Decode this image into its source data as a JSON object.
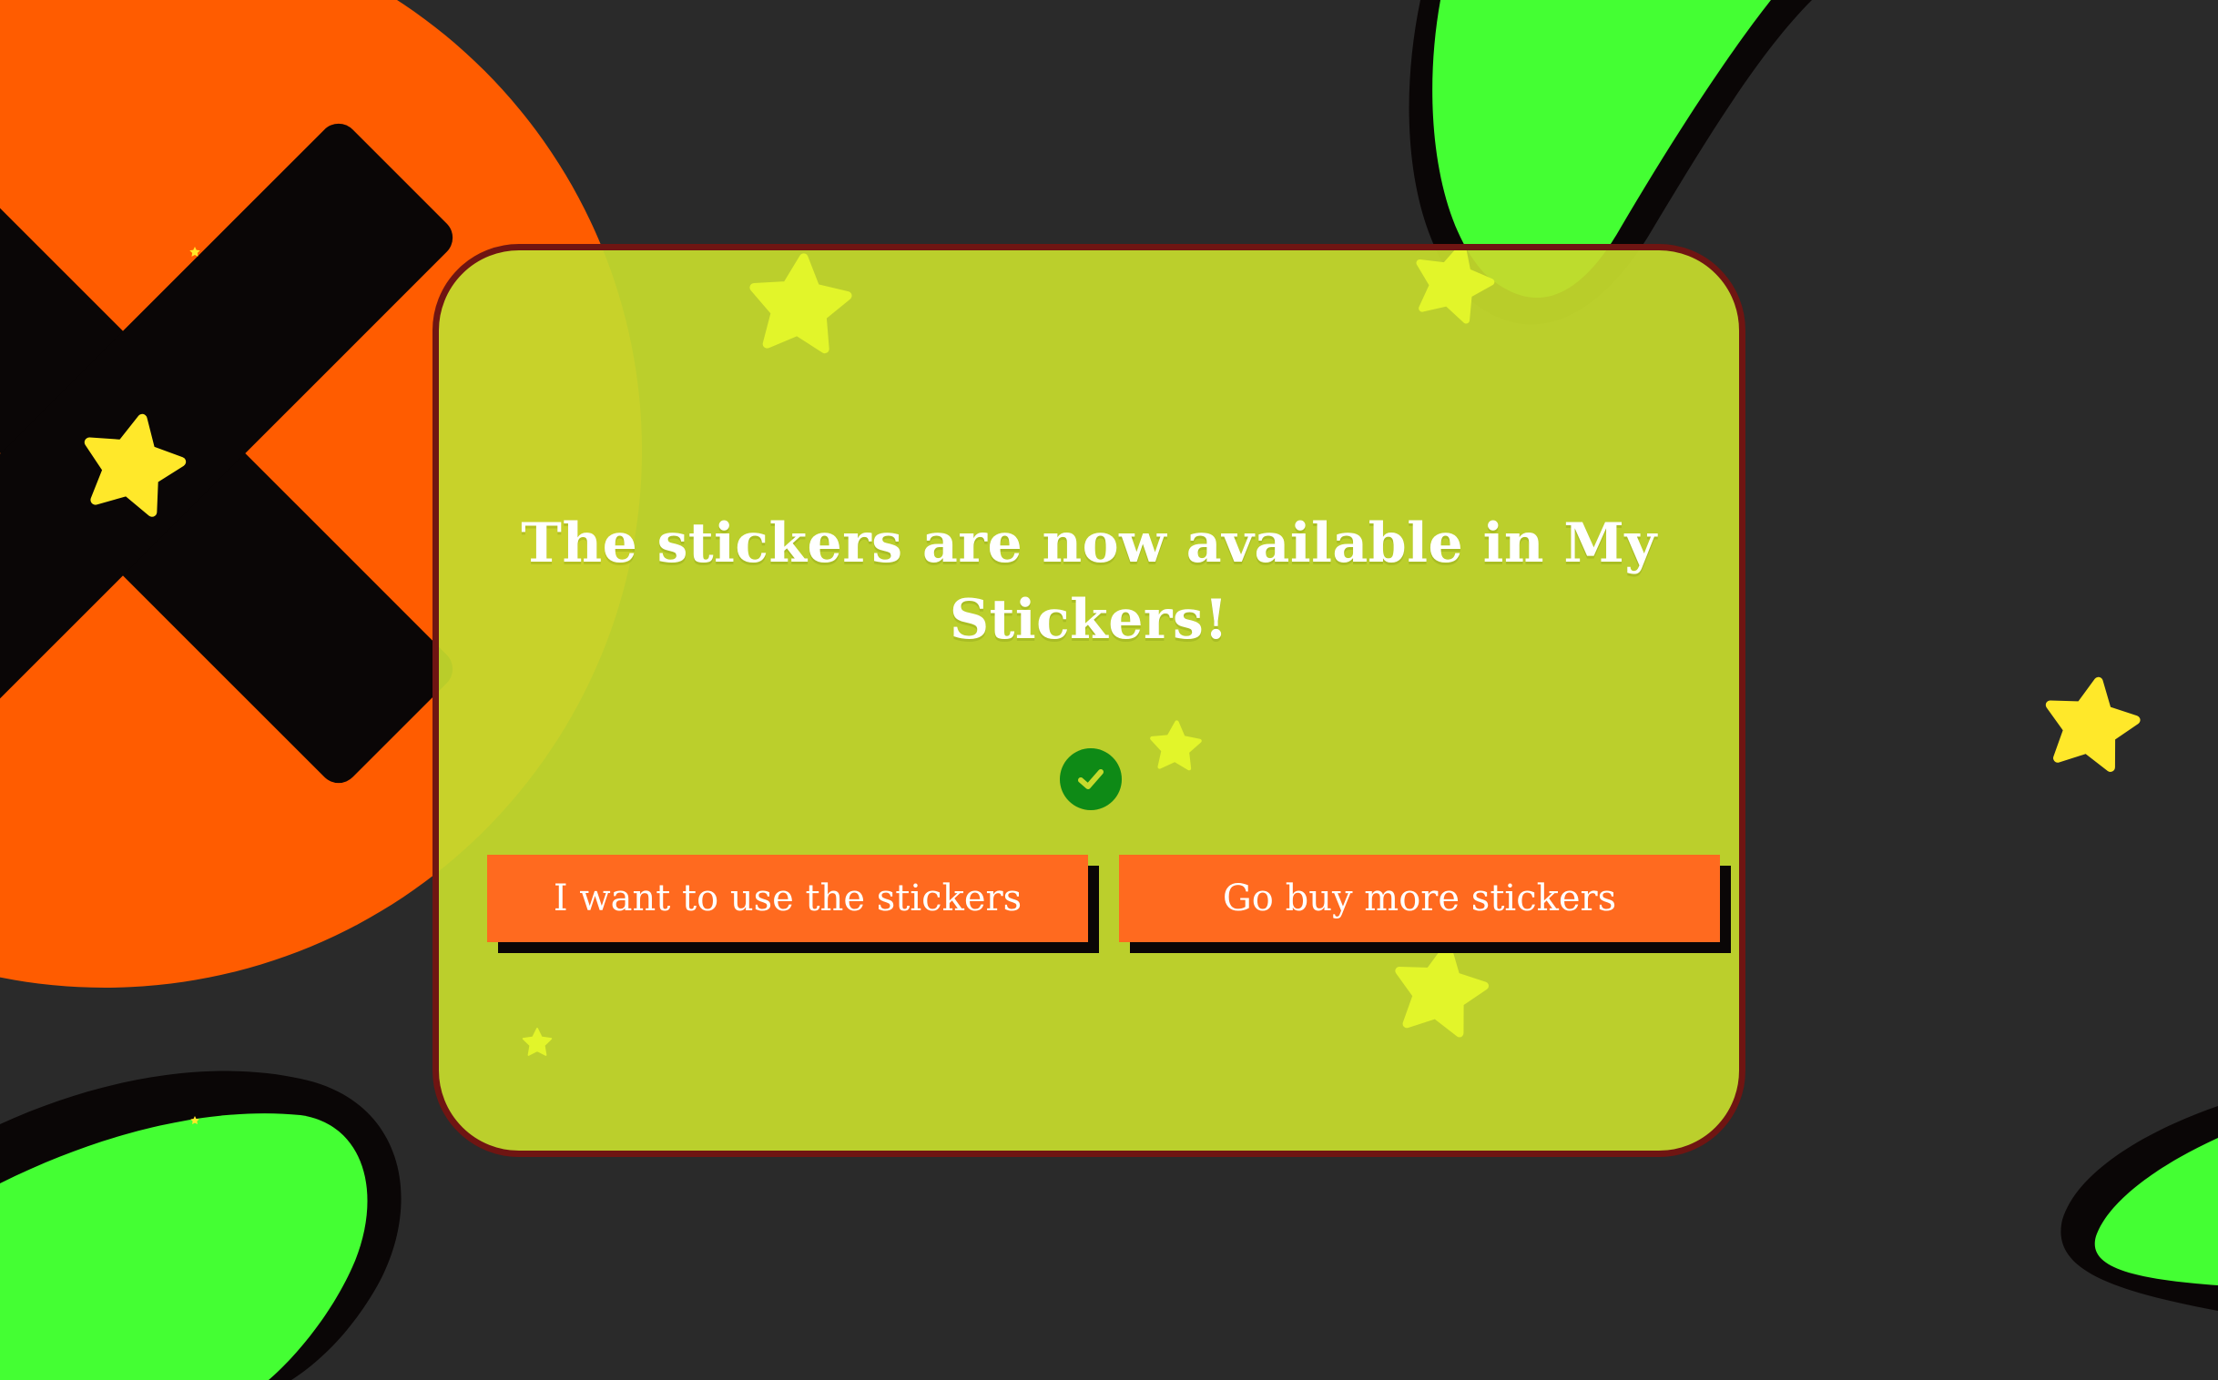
{
  "dialog": {
    "title": "The stickers are now available in My Stickers!",
    "status_icon": "check-circle-icon",
    "buttons": {
      "use_label": "I want to use the stickers",
      "buy_label": "Go buy more stickers"
    }
  },
  "background": {
    "decorations": [
      "x-mark-icon",
      "star-icon",
      "blob-shape"
    ]
  },
  "colors": {
    "page_background": "#2a2a2a",
    "dialog_fill": "#c5da2d",
    "dialog_border": "#6f1512",
    "button_fill": "#ff6a1f",
    "button_shadow": "#0a0606",
    "check_badge": "#0e8a16",
    "orange_circle": "#ff5c00",
    "green_blob": "#44ff33",
    "star_yellow": "#ffe82a"
  }
}
